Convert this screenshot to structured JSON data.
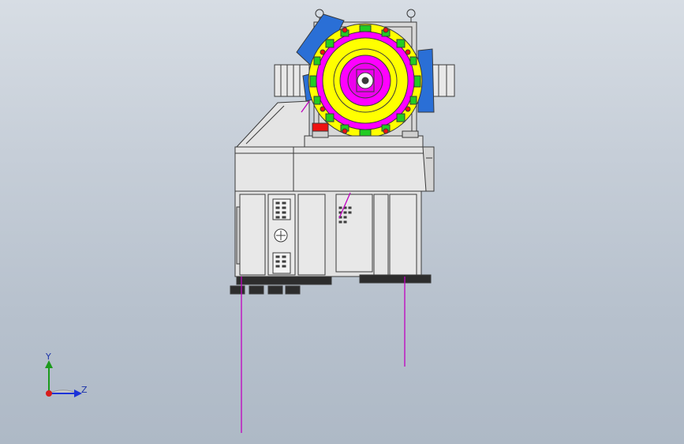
{
  "viewport": {
    "background_top": "#d7dde4",
    "background_bottom": "#aeb9c6"
  },
  "model": {
    "line_color": "#3a3a3a",
    "metal_color": "#dcdcdc",
    "rotor_colors": {
      "yellow": "#ffff00",
      "magenta": "#ff00ff",
      "green": "#22cc22",
      "blue_brackets": "#2a6fd6",
      "red_block": "#ee1111"
    },
    "cable_color": "#c000c0"
  },
  "triad": {
    "y_label": "Y",
    "z_label": "Z",
    "y_color": "#1c9a1c",
    "z_color": "#1c33d8",
    "x_color": "#d81c1c"
  }
}
